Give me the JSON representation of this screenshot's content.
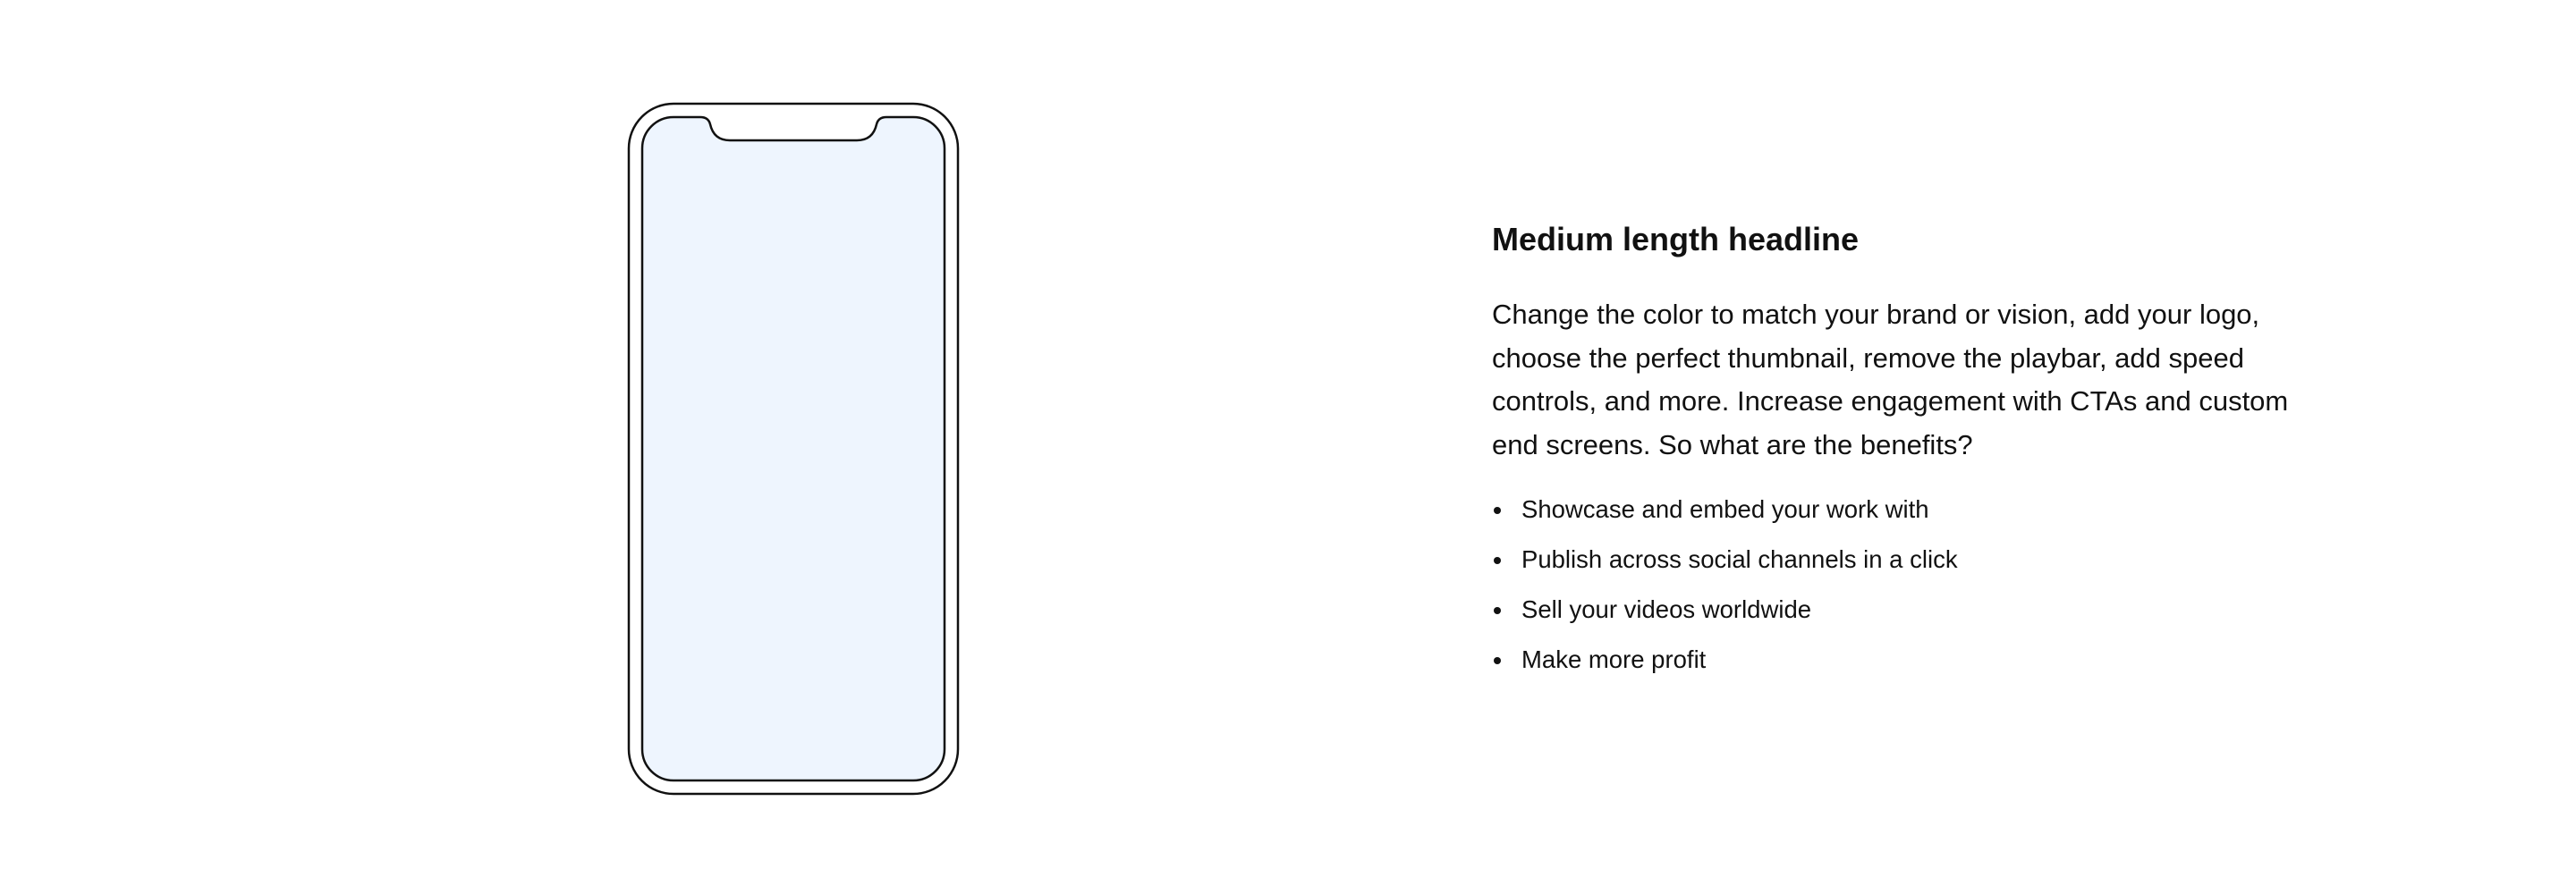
{
  "phone": {
    "icon": "smartphone-outline-icon",
    "screen_color": "#EEF5FE",
    "stroke_color": "#111111"
  },
  "content": {
    "headline": "Medium length headline",
    "body": "Change the color to match your brand or vision, add your logo, choose the perfect thumbnail, remove the playbar, add speed controls, and more. Increase engagement with CTAs and custom end screens. So what are the benefits?",
    "benefits": [
      "Showcase and embed your work with",
      "Publish across social channels in a click",
      "Sell your videos worldwide",
      "Make more profit"
    ]
  }
}
